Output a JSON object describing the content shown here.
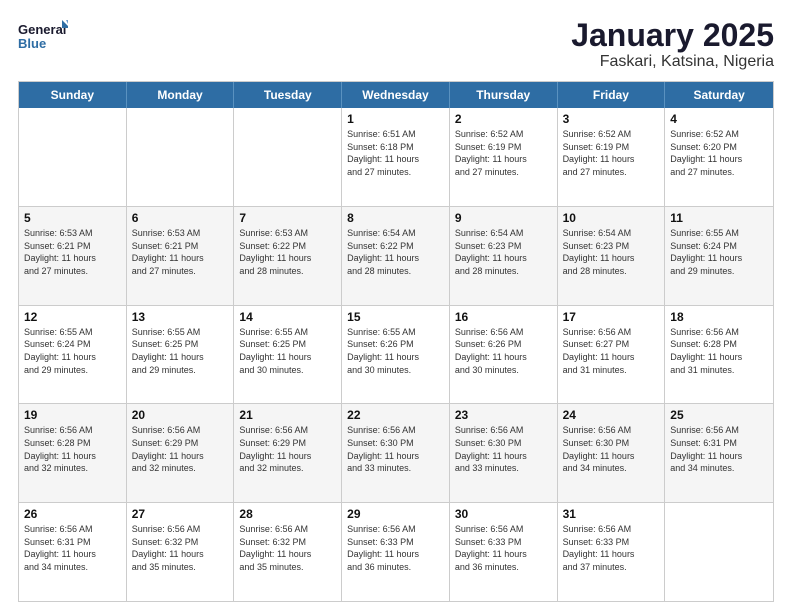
{
  "logo": {
    "line1": "General",
    "line2": "Blue"
  },
  "title": "January 2025",
  "subtitle": "Faskari, Katsina, Nigeria",
  "days": [
    "Sunday",
    "Monday",
    "Tuesday",
    "Wednesday",
    "Thursday",
    "Friday",
    "Saturday"
  ],
  "rows": [
    [
      {
        "num": "",
        "info": ""
      },
      {
        "num": "",
        "info": ""
      },
      {
        "num": "",
        "info": ""
      },
      {
        "num": "1",
        "info": "Sunrise: 6:51 AM\nSunset: 6:18 PM\nDaylight: 11 hours\nand 27 minutes."
      },
      {
        "num": "2",
        "info": "Sunrise: 6:52 AM\nSunset: 6:19 PM\nDaylight: 11 hours\nand 27 minutes."
      },
      {
        "num": "3",
        "info": "Sunrise: 6:52 AM\nSunset: 6:19 PM\nDaylight: 11 hours\nand 27 minutes."
      },
      {
        "num": "4",
        "info": "Sunrise: 6:52 AM\nSunset: 6:20 PM\nDaylight: 11 hours\nand 27 minutes."
      }
    ],
    [
      {
        "num": "5",
        "info": "Sunrise: 6:53 AM\nSunset: 6:21 PM\nDaylight: 11 hours\nand 27 minutes."
      },
      {
        "num": "6",
        "info": "Sunrise: 6:53 AM\nSunset: 6:21 PM\nDaylight: 11 hours\nand 27 minutes."
      },
      {
        "num": "7",
        "info": "Sunrise: 6:53 AM\nSunset: 6:22 PM\nDaylight: 11 hours\nand 28 minutes."
      },
      {
        "num": "8",
        "info": "Sunrise: 6:54 AM\nSunset: 6:22 PM\nDaylight: 11 hours\nand 28 minutes."
      },
      {
        "num": "9",
        "info": "Sunrise: 6:54 AM\nSunset: 6:23 PM\nDaylight: 11 hours\nand 28 minutes."
      },
      {
        "num": "10",
        "info": "Sunrise: 6:54 AM\nSunset: 6:23 PM\nDaylight: 11 hours\nand 28 minutes."
      },
      {
        "num": "11",
        "info": "Sunrise: 6:55 AM\nSunset: 6:24 PM\nDaylight: 11 hours\nand 29 minutes."
      }
    ],
    [
      {
        "num": "12",
        "info": "Sunrise: 6:55 AM\nSunset: 6:24 PM\nDaylight: 11 hours\nand 29 minutes."
      },
      {
        "num": "13",
        "info": "Sunrise: 6:55 AM\nSunset: 6:25 PM\nDaylight: 11 hours\nand 29 minutes."
      },
      {
        "num": "14",
        "info": "Sunrise: 6:55 AM\nSunset: 6:25 PM\nDaylight: 11 hours\nand 30 minutes."
      },
      {
        "num": "15",
        "info": "Sunrise: 6:55 AM\nSunset: 6:26 PM\nDaylight: 11 hours\nand 30 minutes."
      },
      {
        "num": "16",
        "info": "Sunrise: 6:56 AM\nSunset: 6:26 PM\nDaylight: 11 hours\nand 30 minutes."
      },
      {
        "num": "17",
        "info": "Sunrise: 6:56 AM\nSunset: 6:27 PM\nDaylight: 11 hours\nand 31 minutes."
      },
      {
        "num": "18",
        "info": "Sunrise: 6:56 AM\nSunset: 6:28 PM\nDaylight: 11 hours\nand 31 minutes."
      }
    ],
    [
      {
        "num": "19",
        "info": "Sunrise: 6:56 AM\nSunset: 6:28 PM\nDaylight: 11 hours\nand 32 minutes."
      },
      {
        "num": "20",
        "info": "Sunrise: 6:56 AM\nSunset: 6:29 PM\nDaylight: 11 hours\nand 32 minutes."
      },
      {
        "num": "21",
        "info": "Sunrise: 6:56 AM\nSunset: 6:29 PM\nDaylight: 11 hours\nand 32 minutes."
      },
      {
        "num": "22",
        "info": "Sunrise: 6:56 AM\nSunset: 6:30 PM\nDaylight: 11 hours\nand 33 minutes."
      },
      {
        "num": "23",
        "info": "Sunrise: 6:56 AM\nSunset: 6:30 PM\nDaylight: 11 hours\nand 33 minutes."
      },
      {
        "num": "24",
        "info": "Sunrise: 6:56 AM\nSunset: 6:30 PM\nDaylight: 11 hours\nand 34 minutes."
      },
      {
        "num": "25",
        "info": "Sunrise: 6:56 AM\nSunset: 6:31 PM\nDaylight: 11 hours\nand 34 minutes."
      }
    ],
    [
      {
        "num": "26",
        "info": "Sunrise: 6:56 AM\nSunset: 6:31 PM\nDaylight: 11 hours\nand 34 minutes."
      },
      {
        "num": "27",
        "info": "Sunrise: 6:56 AM\nSunset: 6:32 PM\nDaylight: 11 hours\nand 35 minutes."
      },
      {
        "num": "28",
        "info": "Sunrise: 6:56 AM\nSunset: 6:32 PM\nDaylight: 11 hours\nand 35 minutes."
      },
      {
        "num": "29",
        "info": "Sunrise: 6:56 AM\nSunset: 6:33 PM\nDaylight: 11 hours\nand 36 minutes."
      },
      {
        "num": "30",
        "info": "Sunrise: 6:56 AM\nSunset: 6:33 PM\nDaylight: 11 hours\nand 36 minutes."
      },
      {
        "num": "31",
        "info": "Sunrise: 6:56 AM\nSunset: 6:33 PM\nDaylight: 11 hours\nand 37 minutes."
      },
      {
        "num": "",
        "info": ""
      }
    ]
  ]
}
